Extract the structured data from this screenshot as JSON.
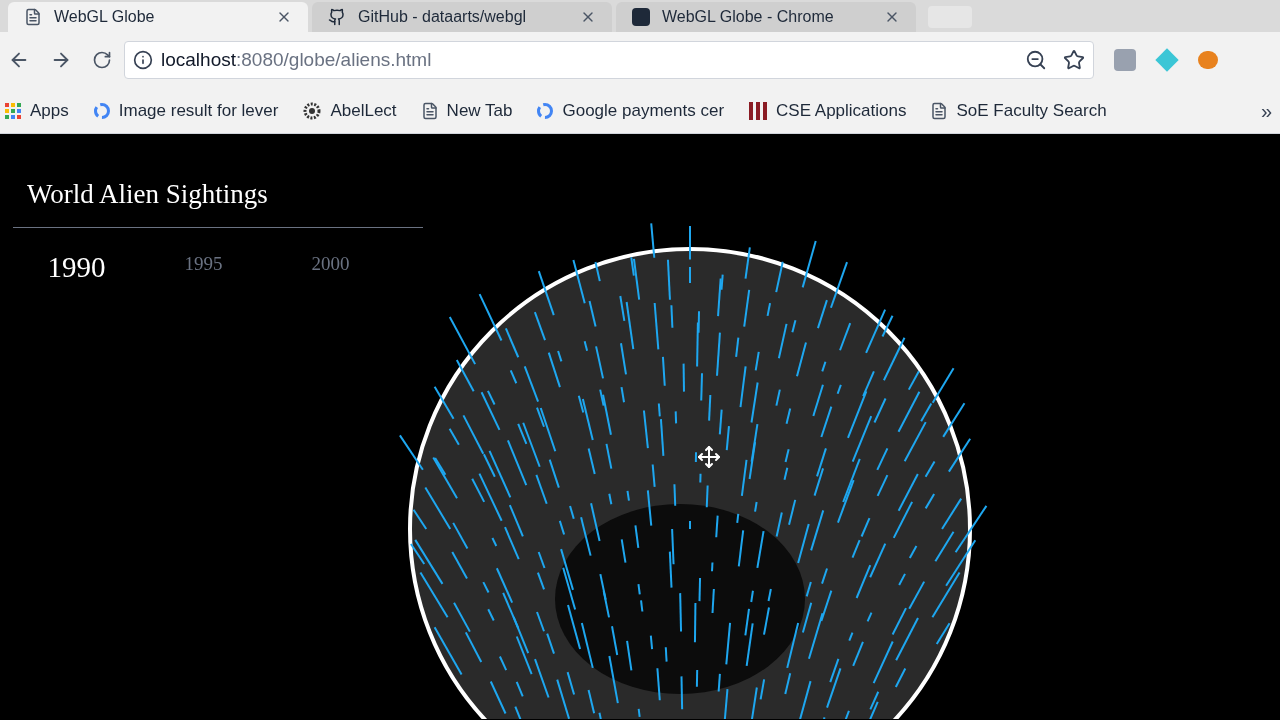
{
  "tabs": [
    {
      "title": "WebGL Globe",
      "selected": true,
      "kind": "page"
    },
    {
      "title": "GitHub - dataarts/webgl",
      "selected": false,
      "kind": "github"
    },
    {
      "title": "WebGL Globe - Chrome",
      "selected": false,
      "kind": "e"
    }
  ],
  "address": {
    "host": "localhost",
    "path": ":8080/globe/aliens.html"
  },
  "bookmarks": [
    {
      "label": "Apps",
      "kind": "apps"
    },
    {
      "label": "Image result for lever",
      "kind": "google"
    },
    {
      "label": "AbelLect",
      "kind": "gear"
    },
    {
      "label": "New Tab",
      "kind": "page"
    },
    {
      "label": "Google payments cer",
      "kind": "google"
    },
    {
      "label": "CSE Applications",
      "kind": "bars"
    },
    {
      "label": "SoE Faculty Search",
      "kind": "page"
    }
  ],
  "bookmarks_more": "»",
  "page": {
    "title": "World Alien Sightings",
    "years": [
      {
        "label": "1990",
        "selected": true
      },
      {
        "label": "1995",
        "selected": false
      },
      {
        "label": "2000",
        "selected": false
      }
    ]
  }
}
